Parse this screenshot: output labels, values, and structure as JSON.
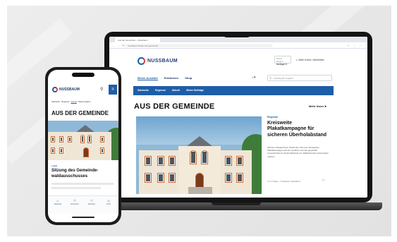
{
  "brand": {
    "name": "NUSSBAUM",
    "color_blue": "#1d5ea8",
    "color_red": "#e23d3d",
    "color_navy": "#1d3b6e"
  },
  "laptop": {
    "browser": {
      "tab_title": "Aus der Gemeinde – Nussbaum",
      "url": "nussbaum.de/aus-der-gemeinde",
      "nav_icons": "← → ⟳ ⌂",
      "tool_icons": "☆ ⋮ ⋯"
    },
    "header": {
      "region_label": "Meine Region",
      "region_value": "Stuttgart ▾",
      "login_label": "Mein Konto / Anmelden",
      "login_icon": "person-icon"
    },
    "main_tabs": [
      "Meine Auswahl",
      "Entdecken",
      "Shop"
    ],
    "search_placeholder": "Suchbegriff eingeben",
    "categories": [
      "Startseite",
      "Regional",
      "Aktuell",
      "Meine Beiträge"
    ],
    "section": {
      "title": "AUS DER GEMEINDE",
      "more_label": "Mehr lesen"
    },
    "article": {
      "kicker": "Regional",
      "title": "Kreisweite Plakatkampagne für sicheren Überholabstand",
      "body": "Sicherer Abstand beim Überholen: Mit einer kreisweiten Plakatkampagne will der Landkreis auf das gesetzlich vorgeschriebene Überholabstand von Radfahrenden aufmerksam machen.",
      "meta": "Vor 3 Tagen · Nussbaum Redaktion"
    }
  },
  "phone": {
    "nav_items": [
      "Startseite",
      "Regional",
      "Aktuell",
      "Meine Region"
    ],
    "section_title": "AUS DER GEMEINDE",
    "article_kicker": "Lokal",
    "article_title": "Sitzung des Gemeinde-waldausschusses",
    "bottom_nav": [
      "Startseite",
      "Entdecken",
      "Merkliste",
      "Profil"
    ]
  }
}
